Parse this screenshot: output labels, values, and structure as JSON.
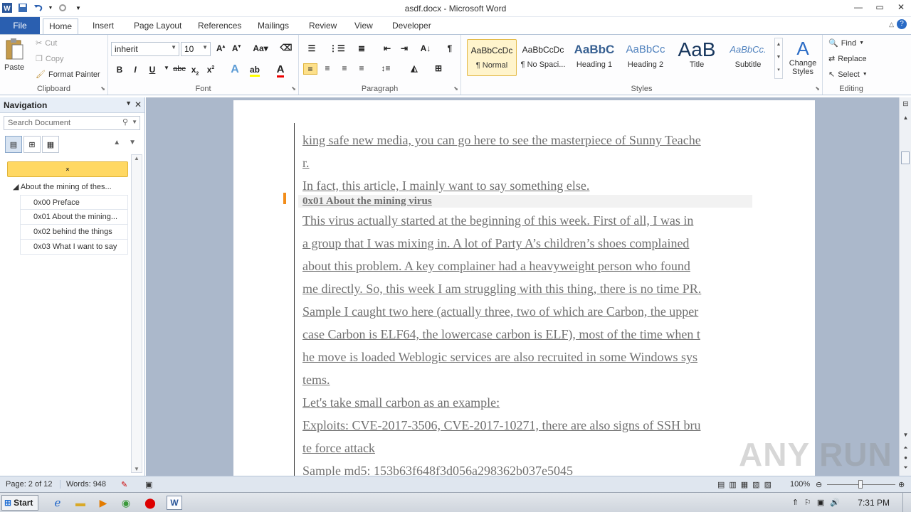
{
  "window": {
    "title": "asdf.docx - Microsoft Word"
  },
  "tabs": [
    "File",
    "Home",
    "Insert",
    "Page Layout",
    "References",
    "Mailings",
    "Review",
    "View",
    "Developer"
  ],
  "ribbon": {
    "clipboard": {
      "label": "Clipboard",
      "paste": "Paste",
      "cut": "Cut",
      "copy": "Copy",
      "format_painter": "Format Painter"
    },
    "font": {
      "label": "Font",
      "font_name": "inherit",
      "font_size": "10"
    },
    "paragraph": {
      "label": "Paragraph"
    },
    "styles": {
      "label": "Styles",
      "items": [
        {
          "sample": "AaBbCcDc",
          "name": "¶ Normal"
        },
        {
          "sample": "AaBbCcDc",
          "name": "¶ No Spaci..."
        },
        {
          "sample": "AaBbC",
          "name": "Heading 1"
        },
        {
          "sample": "AaBbCc",
          "name": "Heading 2"
        },
        {
          "sample": "AaB",
          "name": "Title"
        },
        {
          "sample": "AaBbCc.",
          "name": "Subtitle"
        }
      ],
      "change_styles": "Change Styles"
    },
    "editing": {
      "label": "Editing",
      "find": "Find",
      "replace": "Replace",
      "select": "Select"
    }
  },
  "navigation": {
    "title": "Navigation",
    "search_placeholder": "Search Document",
    "tree": {
      "parent": "About the mining of thes...",
      "children": [
        "0x00 Preface",
        "0x01 About the mining...",
        "0x02 behind the things",
        "0x03 What I want to say"
      ]
    }
  },
  "document": {
    "lines": [
      "king safe new media, you can go here to see the masterpiece of Sunny Teache",
      "r.",
      "In fact, this article, I mainly want to say something else."
    ],
    "heading": "0x01 About the mining virus",
    "lines2": [
      "This virus actually started at the beginning of this week. First of all, I was in",
      "a group that I was mixing in. A lot of Party A’s children’s shoes complained",
      "about this problem. A key complainer had a heavyweight person who found",
      "me directly. So, this week I am struggling with this thing, there is no time PR.",
      "Sample I caught two here (actually three, two of which are Carbon, the upper",
      "case Carbon is ELF64, the lowercase carbon is ELF), most of the time when t",
      "he move is loaded Weblogic services are also recruited in some Windows sys",
      "tems.",
      "Let's take small carbon as an example:",
      "Exploits: CVE-2017-3506, CVE-2017-10271, there are also signs of SSH bru",
      "te force attack",
      "Sample md5: 153b63f648f3d056a298362b037e5045"
    ]
  },
  "status": {
    "page": "Page: 2 of 12",
    "words": "Words: 948",
    "zoom": "100%"
  },
  "taskbar": {
    "start": "Start",
    "time": "7:31 PM"
  },
  "watermark": "ANY RUN"
}
